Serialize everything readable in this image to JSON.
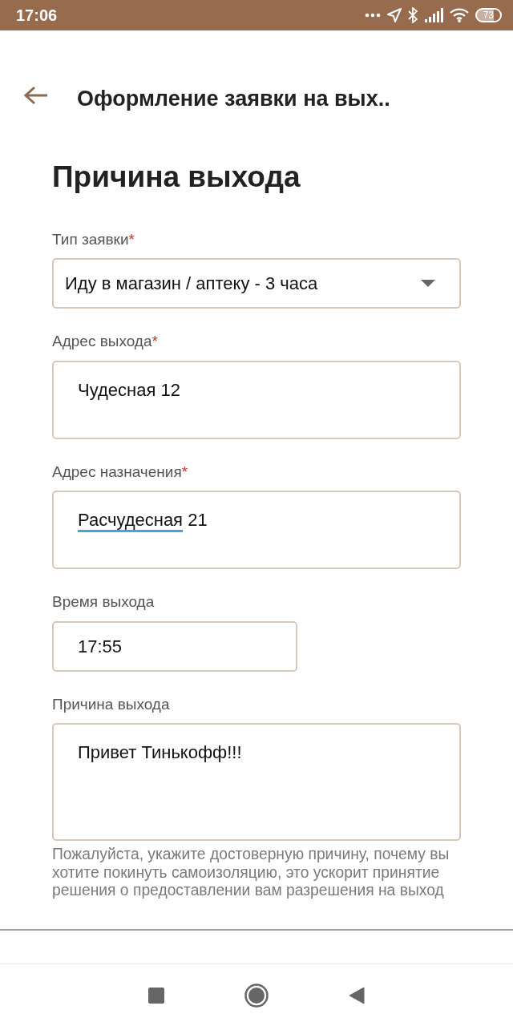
{
  "status_bar": {
    "time": "17:06",
    "battery": "73"
  },
  "header": {
    "title": "Оформление заявки на вых.."
  },
  "section_title": "Причина выхода",
  "fields": [
    {
      "kind": "select",
      "label": "Тип заявки",
      "required_mark": "*",
      "value_parts": [
        {
          "text": "Иду в магазин / аптеку - 3 часа",
          "misspelled": false
        }
      ]
    },
    {
      "kind": "textarea",
      "label": "Адрес выхода",
      "required_mark": "*",
      "value_parts": [
        {
          "text": "Чудесная 12",
          "misspelled": false
        }
      ]
    },
    {
      "kind": "textarea",
      "label": "Адрес назначения",
      "required_mark": "*",
      "value_parts": [
        {
          "text": "Расчудесная",
          "misspelled": true
        },
        {
          "text": " 21",
          "misspelled": false
        }
      ]
    },
    {
      "kind": "time",
      "label": "Время выхода",
      "value_parts": [
        {
          "text": "17:55",
          "misspelled": false
        }
      ]
    },
    {
      "kind": "textarea_large",
      "label": "Причина выхода",
      "value_parts": [
        {
          "text": "Привет Тинькофф!!!",
          "misspelled": false
        }
      ],
      "help": "Пожалуйста, укажите достоверную причину, почему вы хотите покинуть самоизоляцию, это ускорит принятие решения о предоставлении вам разрешения на выход"
    }
  ]
}
